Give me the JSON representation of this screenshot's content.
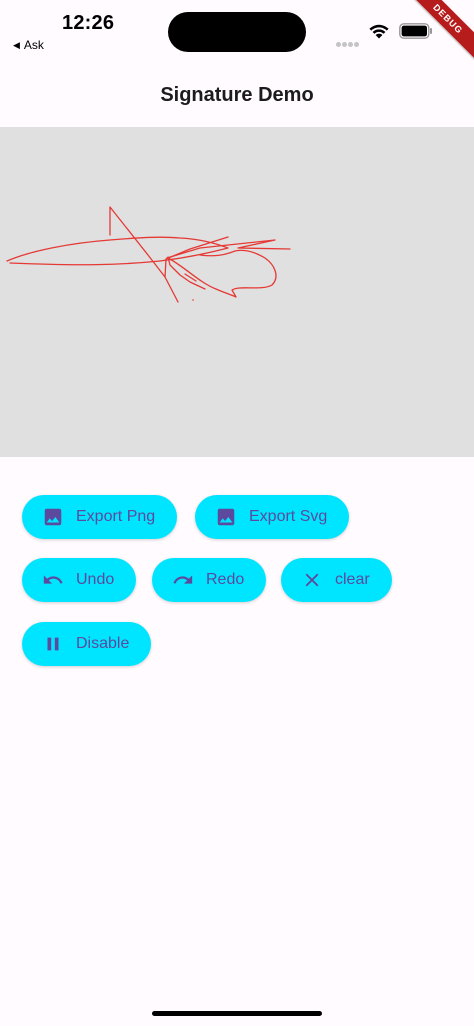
{
  "status_bar": {
    "time": "12:26",
    "back_app_label": "Ask",
    "wifi_icon": "wifi-icon",
    "battery_icon": "battery-icon"
  },
  "debug_banner": "DEBUG",
  "app_bar": {
    "title": "Signature Demo"
  },
  "signature_pad": {
    "background": "#e0e0e0",
    "stroke_color": "#e53935"
  },
  "buttons": {
    "export_png": {
      "label": "Export Png",
      "icon": "image-icon"
    },
    "export_svg": {
      "label": "Export Svg",
      "icon": "image-icon"
    },
    "undo": {
      "label": "Undo",
      "icon": "undo-icon"
    },
    "redo": {
      "label": "Redo",
      "icon": "redo-icon"
    },
    "clear": {
      "label": "clear",
      "icon": "close-icon"
    },
    "disable": {
      "label": "Disable",
      "icon": "pause-icon"
    }
  },
  "colors": {
    "button_bg": "#00e5ff",
    "button_fg": "#5b4a9e",
    "debug_ribbon": "#b71c1c"
  }
}
